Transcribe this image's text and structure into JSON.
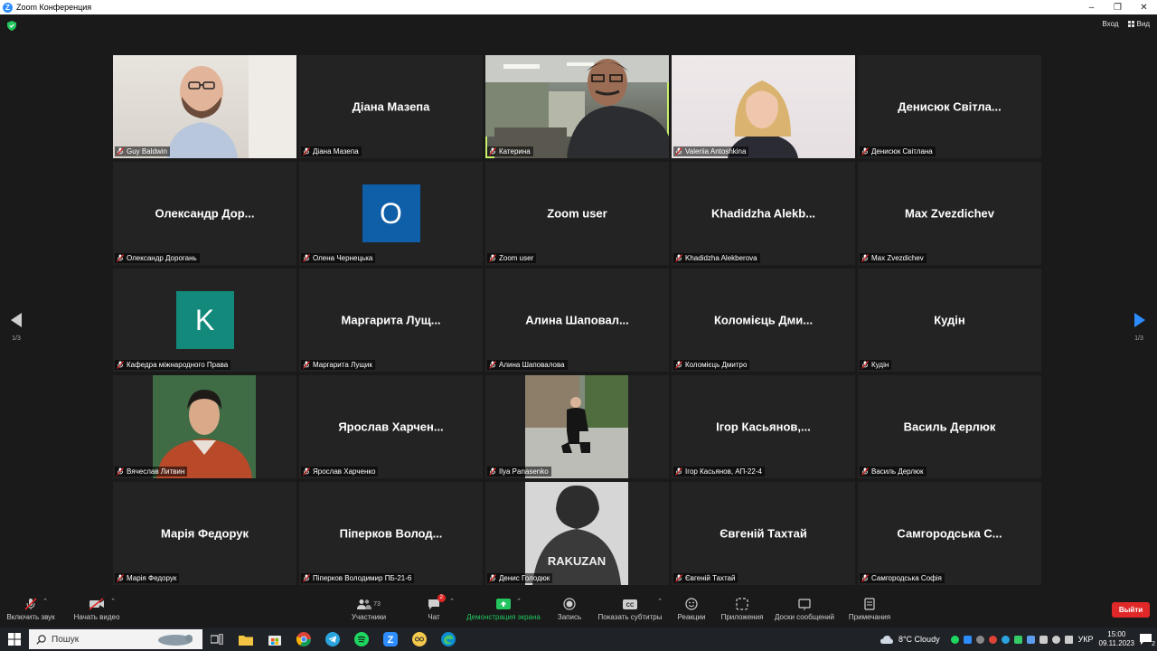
{
  "window": {
    "title": "Zoom Конференция",
    "controls": [
      "–",
      "❐",
      "✕"
    ]
  },
  "topbar": {
    "signin_label": "Вход",
    "view_label": "Вид"
  },
  "pager": {
    "left": "1/3",
    "right": "1/3"
  },
  "tiles": [
    {
      "big": "",
      "label": "Guy Baldwin",
      "kind": "video-guy"
    },
    {
      "big": "Діана Мазепа",
      "label": "Діана Мазепа"
    },
    {
      "big": "",
      "label": "Катерина",
      "kind": "video-kat"
    },
    {
      "big": "",
      "label": "Valeriia Antoshkina",
      "kind": "video-val"
    },
    {
      "big": "Денисюк Світла...",
      "label": "Денисюк Світлана"
    },
    {
      "big": "Олександр Дор...",
      "label": "Олександр Дорогань"
    },
    {
      "big": "",
      "label": "Олена Чернецька",
      "avatar": "О",
      "avatar_color": "#0e5fa8"
    },
    {
      "big": "Zoom user",
      "label": "Zoom user"
    },
    {
      "big": "Khadidzha Alekb...",
      "label": "Khadidzha Alekberova"
    },
    {
      "big": "Max Zvezdichev",
      "label": "Max Zvezdichev"
    },
    {
      "big": "",
      "label": "Кафедра міжнародного Права",
      "avatar": "K",
      "avatar_color": "#12897a"
    },
    {
      "big": "Маргарита Лущ...",
      "label": "Маргарита Лущик"
    },
    {
      "big": "Алина Шаповал...",
      "label": "Алина Шаповалова"
    },
    {
      "big": "Коломієць Дми...",
      "label": "Коломієць Дмитро"
    },
    {
      "big": "Кудін",
      "label": "Кудін"
    },
    {
      "big": "",
      "label": "Вячеслав Литвин",
      "kind": "photo-vyach"
    },
    {
      "big": "Ярослав Харчен...",
      "label": "Ярослав Харченко"
    },
    {
      "big": "",
      "label": "Ilya Panasenko",
      "kind": "photo-ilya"
    },
    {
      "big": "Ігор Касьянов,...",
      "label": "Ігор Касьянов, АП-22-4"
    },
    {
      "big": "Василь Дерлюк",
      "label": "Василь Дерлюк"
    },
    {
      "big": "Марія Федорук",
      "label": "Марія Федорук"
    },
    {
      "big": "Піперков Волод...",
      "label": "Піперков Володимир ПБ-21-6"
    },
    {
      "big": "",
      "label": "Денис Голодюк",
      "kind": "photo-rakuzan",
      "photo_text": "RAKUZAN"
    },
    {
      "big": "Євгеній Тахтай",
      "label": "Євгеній Тахтай"
    },
    {
      "big": "Самгородська С...",
      "label": "Самгородська Софія"
    }
  ],
  "toolbar": {
    "unmute": "Включить звук",
    "start_video": "Начать видео",
    "participants": "Участники",
    "participants_count": "73",
    "chat": "Чат",
    "chat_badge": "2",
    "share": "Демонстрация экрана",
    "record": "Запись",
    "captions": "Показать субтитры",
    "reactions": "Реакции",
    "apps": "Приложения",
    "whiteboards": "Доски сообщений",
    "notes": "Примечания",
    "leave": "Выйти"
  },
  "taskbar": {
    "search_placeholder": "Пошук",
    "weather": "8°C  Cloudy",
    "lang": "УКР",
    "time": "15:00",
    "date": "09.11.2023",
    "notifications": "2"
  }
}
